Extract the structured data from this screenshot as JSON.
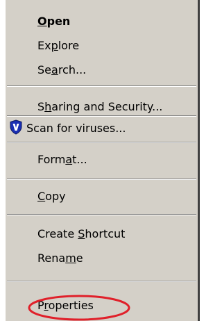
{
  "menu": {
    "items": {
      "open": {
        "pre": "",
        "accel": "O",
        "post": "pen"
      },
      "explore": {
        "pre": "Ex",
        "accel": "p",
        "post": "lore"
      },
      "search": {
        "pre": "Se",
        "accel": "a",
        "post": "rch..."
      },
      "sharing": {
        "pre": "S",
        "accel": "h",
        "post": "aring and Security..."
      },
      "scan": {
        "text": "Scan for viruses..."
      },
      "format": {
        "pre": "Form",
        "accel": "a",
        "post": "t..."
      },
      "copy": {
        "pre": "",
        "accel": "C",
        "post": "opy"
      },
      "shortcut": {
        "pre": "Create ",
        "accel": "S",
        "post": "hortcut"
      },
      "rename": {
        "pre": "Rena",
        "accel": "m",
        "post": "e"
      },
      "properties": {
        "pre": "P",
        "accel": "r",
        "post": "operties"
      }
    },
    "colors": {
      "menu_bg": "#d4d0c8",
      "shield": "#1a2fb3",
      "highlight_ellipse": "#e0202a"
    },
    "icons": {
      "scan": "shield-icon"
    }
  }
}
